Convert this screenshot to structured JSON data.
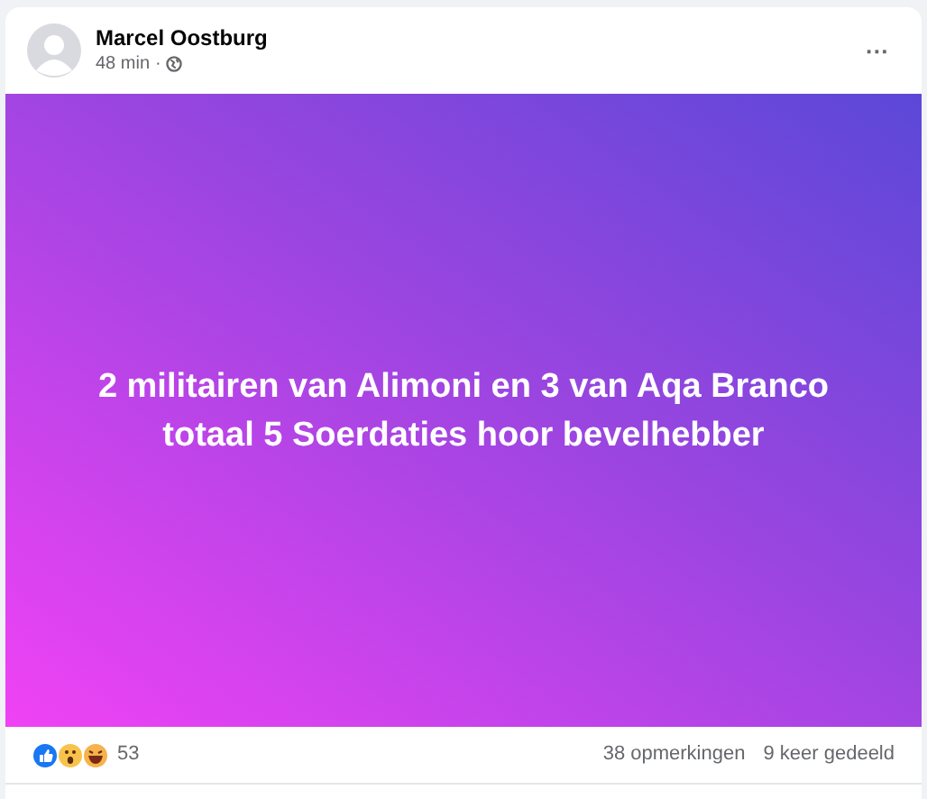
{
  "post": {
    "author": "Marcel Oostburg",
    "time": "48 min",
    "separator": "·",
    "menu": "···",
    "text_lines": [
      "2 militairen van Alimoni en 3 van Aqa Branco",
      "totaal 5 Soerdaties hoor bevelhebber"
    ],
    "reaction_count": "53",
    "comments": "38 opmerkingen",
    "shares": "9 keer gedeeld"
  }
}
